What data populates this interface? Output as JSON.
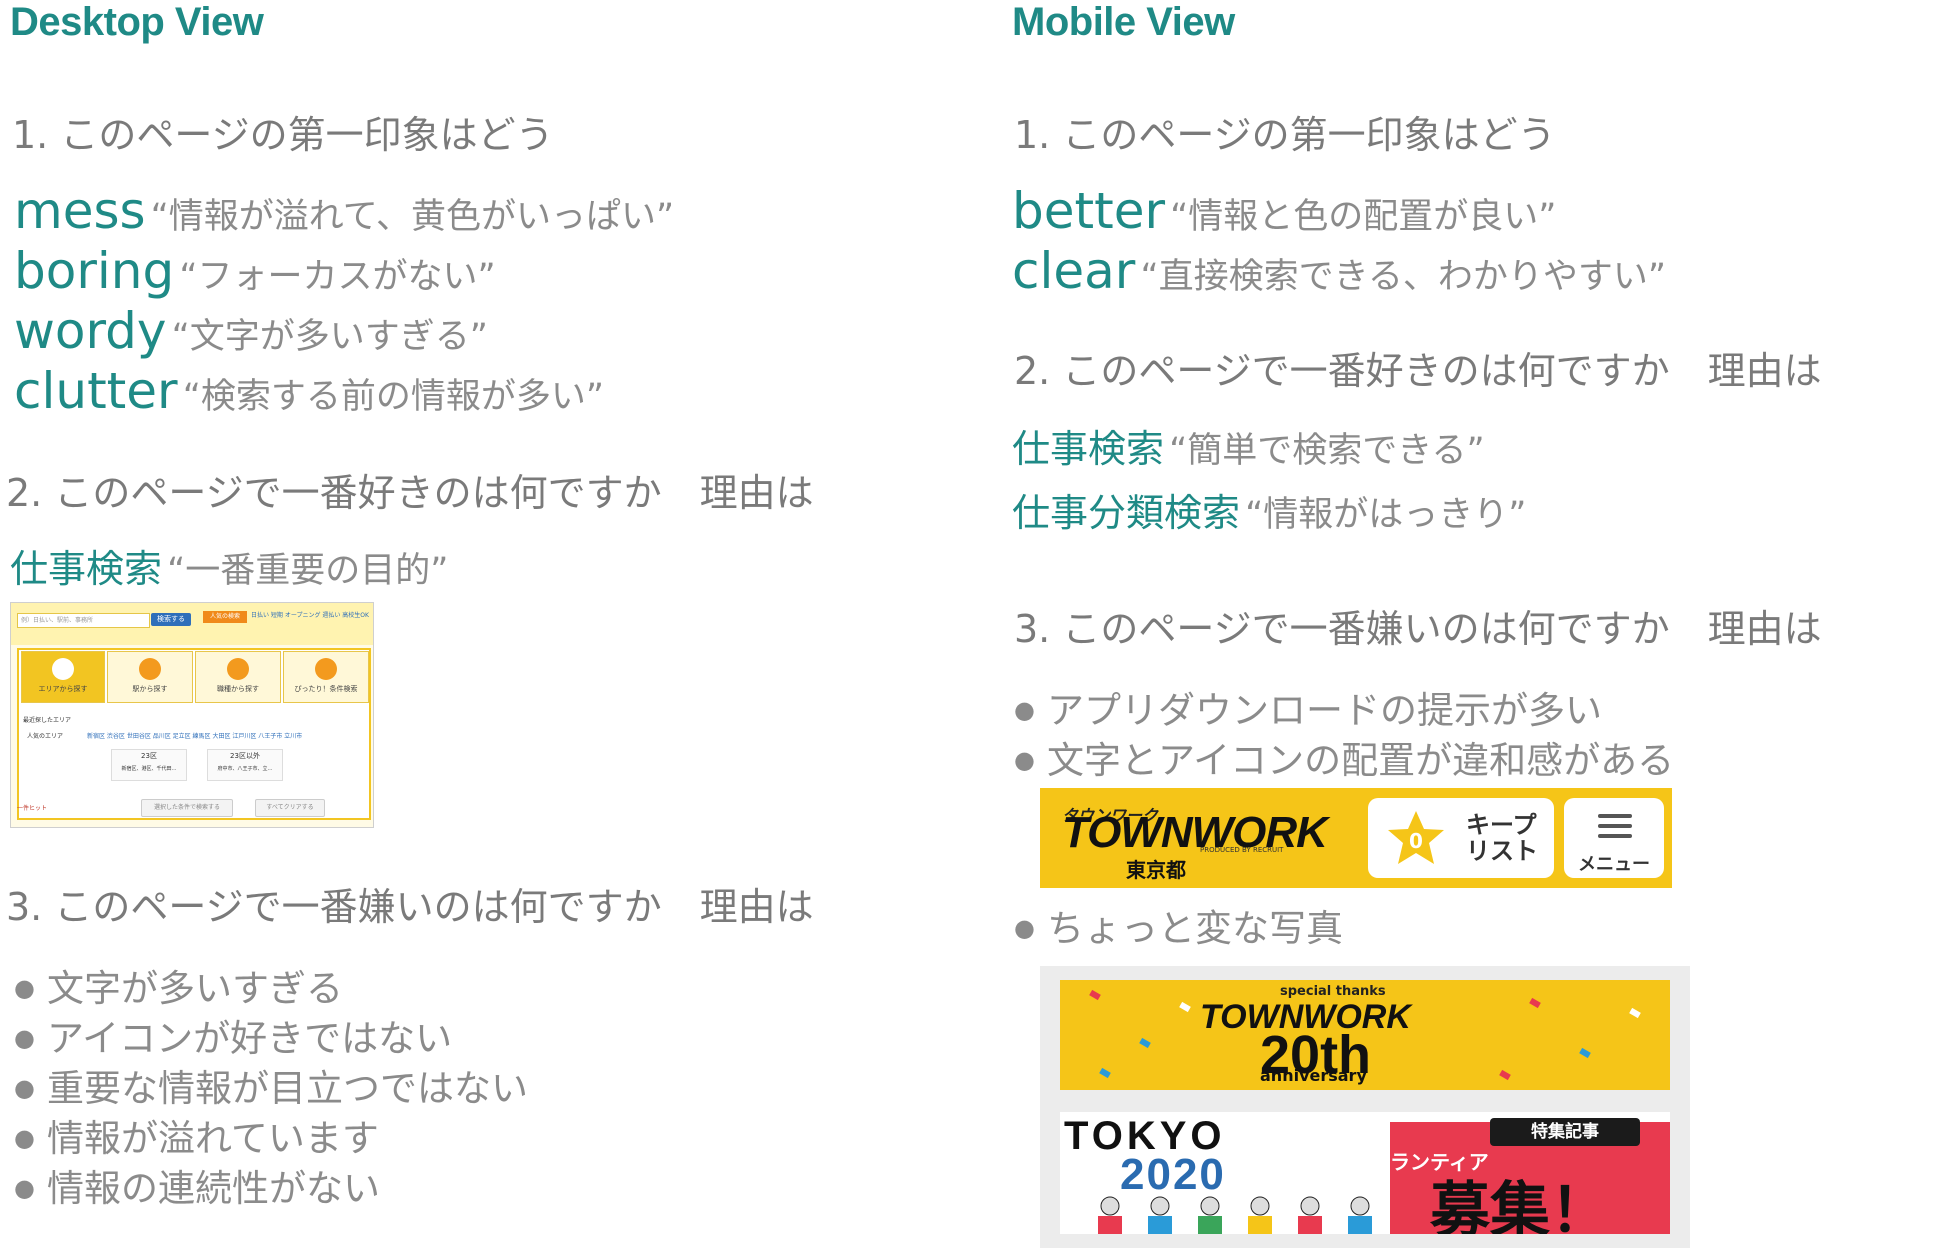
{
  "desktop": {
    "heading": "Desktop View",
    "q1": "1. このページの第一印象はどう",
    "impressions": [
      {
        "term": "mess",
        "quote": "“情報が溢れて、黄色がいっぱい”"
      },
      {
        "term": "boring",
        "quote": "“フォーカスがない”"
      },
      {
        "term": "wordy",
        "quote": "“文字が多いすぎる”"
      },
      {
        "term": "clutter",
        "quote": "“検索する前の情報が多い”"
      }
    ],
    "q2": "2. このページで一番好きのは何ですか　理由は",
    "likes": [
      {
        "term": "仕事検索",
        "quote": "“一番重要の目的”"
      }
    ],
    "screenshot": {
      "search_placeholder": "例）日払い、駅前、事務所",
      "search_button": "検索する",
      "popular_label": "人気の検索",
      "popular_tags": "日払い 短期 オープニング 週払い 高校生OK",
      "tabs": [
        "エリアから探す",
        "駅から探す",
        "職種から探す",
        "ぴったり！条件検索"
      ],
      "recent_area": "最近探したエリア",
      "popular_area": "人気のエリア",
      "area_links": "新宿区 渋谷区 世田谷区 品川区 足立区 練馬区 大田区 江戸川区 八王子市 立川市",
      "box1_title": "23区",
      "box1_sub": "新宿区、港区、千代田…",
      "box2_title": "23区以外",
      "box2_sub": "府中市、八王子市、立…",
      "hits": "一件ヒット",
      "btn_search_selected": "選択した条件で検索する",
      "btn_clear": "すべてクリアする"
    },
    "q3": "3. このページで一番嫌いのは何ですか　理由は",
    "dislikes": [
      "文字が多いすぎる",
      "アイコンが好きではない",
      "重要な情報が目立つではない",
      "情報が溢れています",
      "情報の連続性がない"
    ]
  },
  "mobile": {
    "heading": "Mobile View",
    "q1": "1. このページの第一印象はどう",
    "impressions": [
      {
        "term": "better",
        "quote": "“情報と色の配置が良い”"
      },
      {
        "term": "clear",
        "quote": "“直接検索できる、わかりやすい”"
      }
    ],
    "q2": "2. このページで一番好きのは何ですか　理由は",
    "likes": [
      {
        "term": "仕事検索",
        "quote": "“簡単で検索できる”"
      },
      {
        "term": "仕事分類検索",
        "quote": "“情報がはっきり”"
      }
    ],
    "q3": "3. このページで一番嫌いのは何ですか　理由は",
    "dislikes_a": [
      "アプリダウンロードの提示が多い",
      "文字とアイコンの配置が違和感がある"
    ],
    "header_image": {
      "logo_kana": "タウンワーク",
      "logo": "TOWNWORK",
      "produced": "PRODUCED BY RECRUIT",
      "pref": "東京都",
      "keep_count": "0",
      "keep_label": "キープリスト",
      "menu_label": "メニュー"
    },
    "dislikes_b": [
      "ちょっと変な写真"
    ],
    "banner1": {
      "line1": "special thanks",
      "line2": "TOWNWORK",
      "line3": "20th",
      "line4": "anniversary"
    },
    "banner2": {
      "tokyo": "TOKYO",
      "year": "2020",
      "badge": "特集記事",
      "sub": "ボランティア",
      "main": "募集！"
    }
  },
  "colors": {
    "accent": "#1f8a86",
    "text_gray": "#7a7a7a",
    "townwork_yellow": "#f5c518"
  }
}
